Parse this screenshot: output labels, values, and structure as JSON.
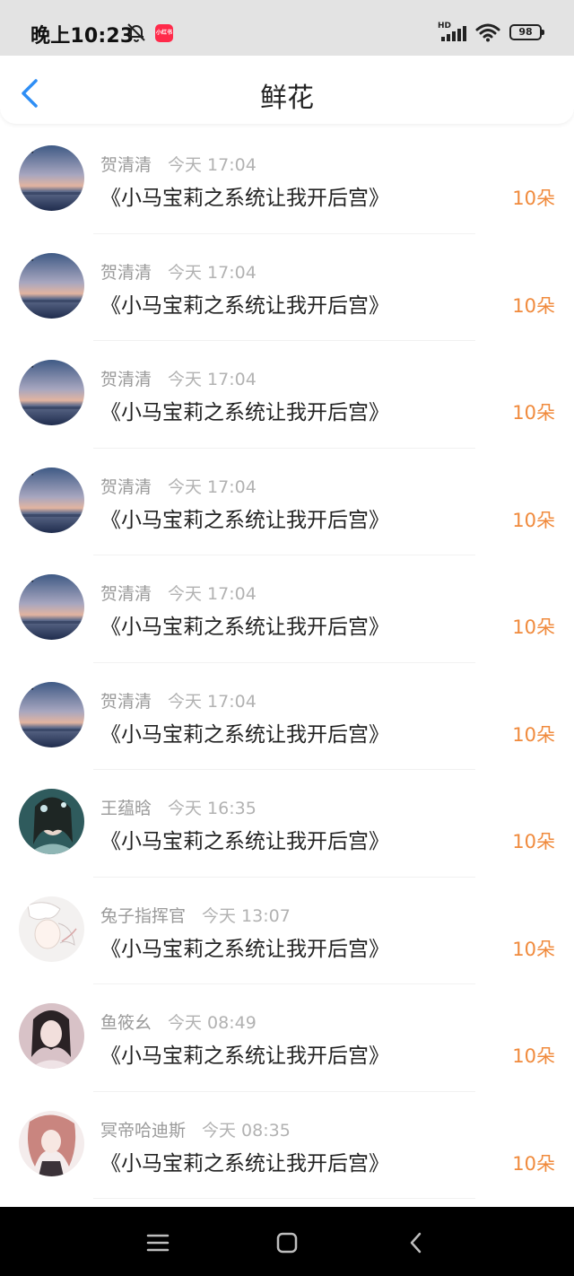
{
  "status_bar": {
    "time": "晚上10:23",
    "app_badge": "小红书",
    "battery": "98",
    "network": "HD"
  },
  "header": {
    "title": "鲜花"
  },
  "entries": [
    {
      "name": "贺清清",
      "time": "今天 17:04",
      "book": "《小马宝莉之系统让我开后宫》",
      "amount": "10朵",
      "avatar": "sunset"
    },
    {
      "name": "贺清清",
      "time": "今天 17:04",
      "book": "《小马宝莉之系统让我开后宫》",
      "amount": "10朵",
      "avatar": "sunset"
    },
    {
      "name": "贺清清",
      "time": "今天 17:04",
      "book": "《小马宝莉之系统让我开后宫》",
      "amount": "10朵",
      "avatar": "sunset"
    },
    {
      "name": "贺清清",
      "time": "今天 17:04",
      "book": "《小马宝莉之系统让我开后宫》",
      "amount": "10朵",
      "avatar": "sunset"
    },
    {
      "name": "贺清清",
      "time": "今天 17:04",
      "book": "《小马宝莉之系统让我开后宫》",
      "amount": "10朵",
      "avatar": "sunset"
    },
    {
      "name": "贺清清",
      "time": "今天 17:04",
      "book": "《小马宝莉之系统让我开后宫》",
      "amount": "10朵",
      "avatar": "sunset"
    },
    {
      "name": "王蕴晗",
      "time": "今天 16:35",
      "book": "《小马宝莉之系统让我开后宫》",
      "amount": "10朵",
      "avatar": "teal-portrait"
    },
    {
      "name": "兔子指挥官",
      "time": "今天 13:07",
      "book": "《小马宝莉之系统让我开后宫》",
      "amount": "10朵",
      "avatar": "white-sketch"
    },
    {
      "name": "鱼筱幺",
      "time": "今天 08:49",
      "book": "《小马宝莉之系统让我开后宫》",
      "amount": "10朵",
      "avatar": "pink-portrait"
    },
    {
      "name": "冥帝哈迪斯",
      "time": "今天 08:35",
      "book": "《小马宝莉之系统让我开后宫》",
      "amount": "10朵",
      "avatar": "red-hair"
    }
  ],
  "colors": {
    "accent": "#f08a3c",
    "back_icon": "#2e8ef5",
    "status_bar_bg": "#e3e3e3",
    "nav_bar_bg": "#000000"
  },
  "nav_bar": {
    "icons": [
      "menu-icon",
      "home-square-icon",
      "back-chevron-icon"
    ]
  }
}
